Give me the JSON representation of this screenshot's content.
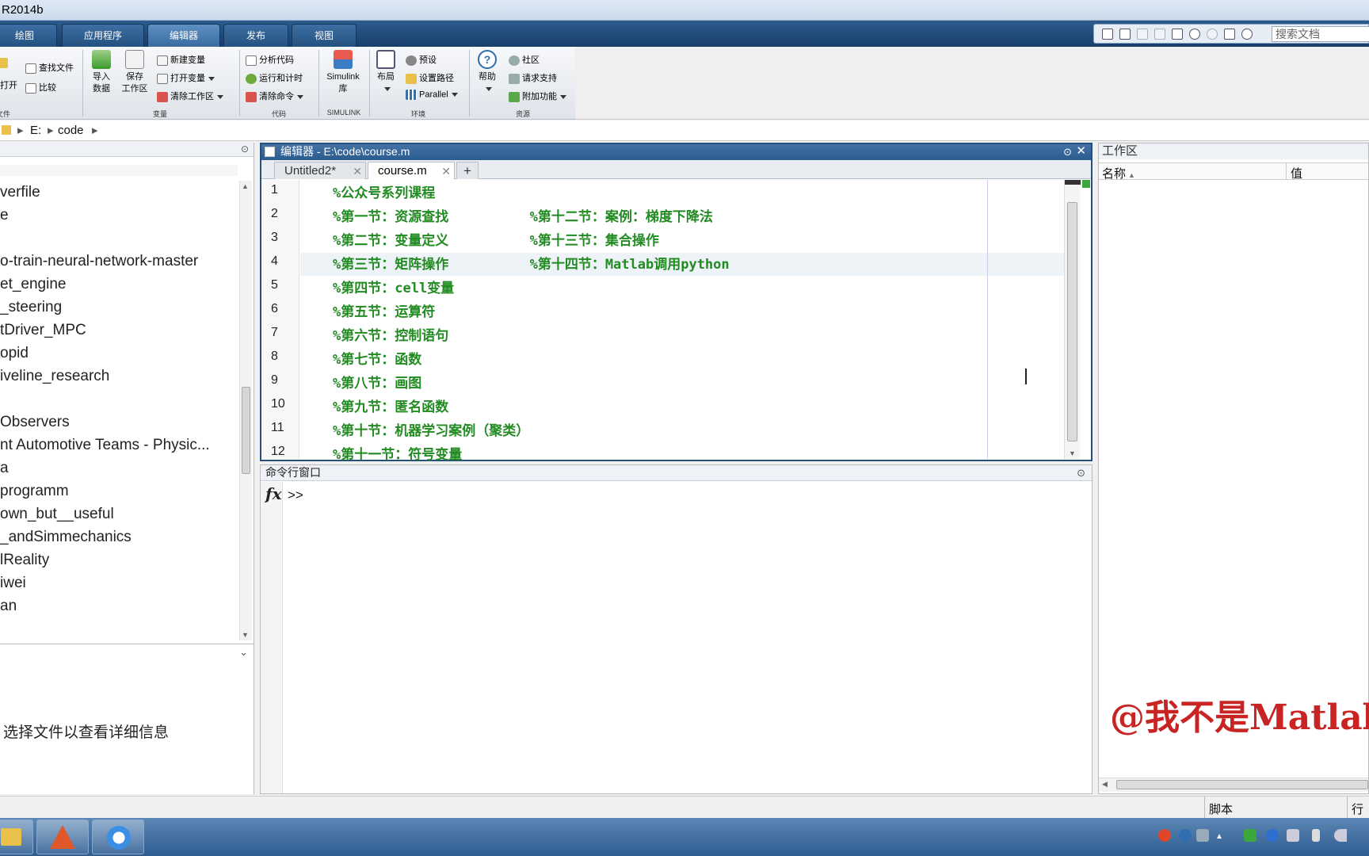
{
  "window": {
    "title": "R2014b"
  },
  "ribbon_tabs": [
    {
      "label": "绘图",
      "active": false
    },
    {
      "label": "应用程序",
      "active": false
    },
    {
      "label": "编辑器",
      "active": true
    },
    {
      "label": "发布",
      "active": false
    },
    {
      "label": "视图",
      "active": false
    }
  ],
  "search": {
    "placeholder": "搜索文档"
  },
  "ribbon": {
    "open": "打开",
    "find_files": "查找文件",
    "compare": "比较",
    "file_group": "文件",
    "import_data": "导入\n数据",
    "save_workspace": "保存\n工作区",
    "new_variable": "新建变量",
    "open_variable": "打开变量",
    "clear_workspace": "清除工作区",
    "variable_group": "变量",
    "analyze_code": "分析代码",
    "run_and_time": "运行和计时",
    "clear_commands": "清除命令",
    "code_group": "代码",
    "simulink_library": "Simulink\n库",
    "simulink_group": "SIMULINK",
    "layout": "布局",
    "preferences": "预设",
    "set_path": "设置路径",
    "parallel": "Parallel",
    "environment_group": "环境",
    "help": "帮助",
    "community": "社区",
    "request_support": "请求支持",
    "add_ons": "附加功能",
    "resources_group": "资源"
  },
  "address": {
    "drive": "E:",
    "folder": "code"
  },
  "file_browser": {
    "items": [
      "verfile",
      "e",
      "o-train-neural-network-master",
      "et_engine",
      "_steering",
      "tDriver_MPC",
      "opid",
      "iveline_research",
      "Observers",
      "nt Automotive Teams - Physic...",
      "a",
      "programm",
      "own_but__useful",
      "_andSimmechanics",
      "lReality",
      "iwei",
      "an"
    ],
    "details_text": "选择文件以查看详细信息"
  },
  "editor": {
    "title": "编辑器 - E:\\code\\course.m",
    "tabs": [
      {
        "label": "Untitled2*",
        "active": false
      },
      {
        "label": "course.m",
        "active": true
      }
    ],
    "add_tab": "+",
    "current_line": 4,
    "lines": [
      {
        "num": "1",
        "text": "%公众号系列课程"
      },
      {
        "num": "2",
        "text": "%第一节：资源查找          %第十二节：案例：梯度下降法"
      },
      {
        "num": "3",
        "text": "%第二节：变量定义          %第十三节：集合操作"
      },
      {
        "num": "4",
        "text": "%第三节：矩阵操作          %第十四节：Matlab调用python"
      },
      {
        "num": "5",
        "text": "%第四节：cell变量"
      },
      {
        "num": "6",
        "text": "%第五节：运算符"
      },
      {
        "num": "7",
        "text": "%第六节：控制语句"
      },
      {
        "num": "8",
        "text": "%第七节：函数"
      },
      {
        "num": "9",
        "text": "%第八节：画图"
      },
      {
        "num": "10",
        "text": "%第九节：匿名函数"
      },
      {
        "num": "11",
        "text": "%第十节：机器学习案例（聚类）"
      },
      {
        "num": "12",
        "text": "%第十一节：符号变量"
      }
    ]
  },
  "command_window": {
    "title": "命令行窗口",
    "fx": "fx",
    "prompt": ">>"
  },
  "workspace": {
    "title": "工作区",
    "col_name": "名称",
    "col_value": "值",
    "watermark": "@我不是Matlab"
  },
  "status_bar": {
    "script": "脚本",
    "row": "行"
  },
  "colors": {
    "comment_green": "#228b22",
    "ribbon_blue": "#173f6b",
    "watermark_red": "#c82424"
  }
}
